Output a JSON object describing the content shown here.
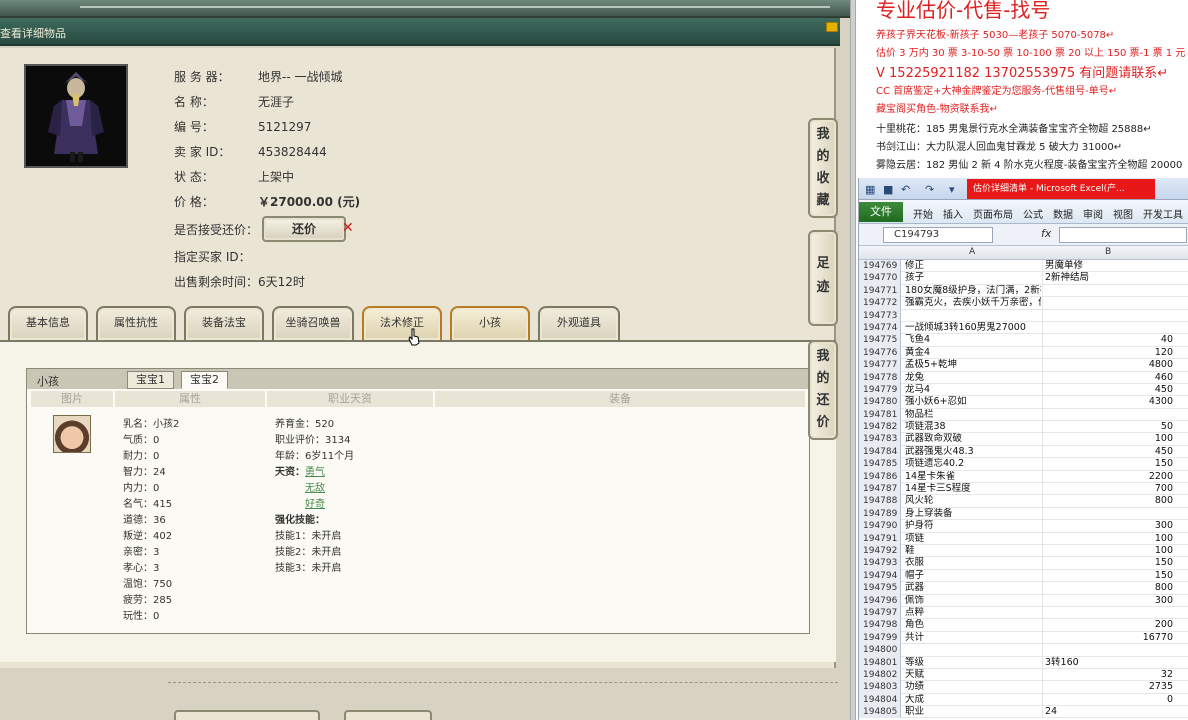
{
  "game": {
    "header_title": "查看详细物品",
    "info": {
      "server_label": "服 务 器：",
      "server_value": "地界-- 一战倾城",
      "name_label": "名 称：",
      "name_value": "无涯子",
      "id_label": "编 号：",
      "id_value": "5121297",
      "seller_label": "卖 家 ID：",
      "seller_value": "453828444",
      "status_label": "状 态：",
      "status_value": "上架中",
      "price_label": "价 格：",
      "price_value": "￥27000.00 (元)",
      "counter_label": "是否接受还价：",
      "counter_button": "还价",
      "buyer_label": "指定买家 ID：",
      "buyer_value": "",
      "remaining_label": "出售剩余时间：",
      "remaining_value": "6天12时"
    },
    "tabs": [
      "基本信息",
      "属性抗性",
      "装备法宝",
      "坐骑召唤兽",
      "法术修正",
      "小孩",
      "外观道具"
    ],
    "side_buttons": [
      "我的收藏",
      "足迹",
      "我的还价"
    ],
    "child_panel": {
      "title": "小孩",
      "subtabs": [
        "宝宝1",
        "宝宝2"
      ],
      "columns": [
        "图片",
        "属性",
        "职业天资",
        "装备"
      ],
      "stats_col1": [
        "乳名：小孩2",
        "气质：0",
        "耐力：0",
        "智力：24",
        "内力：0",
        "名气：415",
        "道德：36",
        "叛逆：402",
        "亲密：3",
        "孝心：3",
        "温饱：750",
        "疲劳：285",
        "玩性：0"
      ],
      "stats_col2": [
        "养育金：520",
        "职业评价：3134",
        "年龄：6岁11个月",
        "天资："
      ],
      "talents": [
        "勇气",
        "无敌",
        "好奇"
      ],
      "skills_label": "强化技能：",
      "skills": [
        "技能1：未开启",
        "技能2：未开启",
        "技能3：未开启"
      ]
    }
  },
  "notes": {
    "title": "专业估价-代售-找号",
    "lines": [
      {
        "text": "养孩子界天花板-新孩子 5030—老孩子 5070-5078↵",
        "style": "red"
      },
      {
        "text": "估价 3 万内 30 票 3-10-50 票 10-100 票 20 以上 150 票-1 票 1 元",
        "style": "red"
      },
      {
        "text": "V 15225921182    13702553975 有问题请联系↵",
        "style": "red big"
      },
      {
        "text": "CC 首席鉴定+大神金牌鉴定为您服务-代售组号-单号↵",
        "style": "red"
      },
      {
        "text": "藏宝阁买角色-物资联系我↵",
        "style": "red"
      },
      {
        "text": "十里桃花：185 男鬼景行克水全满装备宝宝齐全物超 25888↵",
        "style": "dark"
      },
      {
        "text": "书剑江山：大力队混人回血鬼甘霖龙 5 破大力 31000↵",
        "style": "dark"
      },
      {
        "text": "雾隐云居：182 男仙 2 新 4 阶水克火程度-装备宝宝齐全物超 20000",
        "style": "dark"
      }
    ]
  },
  "excel": {
    "window_title": "估价详细清单 - Microsoft Excel(产...",
    "file_tab": "文件",
    "menus": [
      "开始",
      "插入",
      "页面布局",
      "公式",
      "数据",
      "审阅",
      "视图",
      "开发工具"
    ],
    "name_box": "C194793",
    "fx": "fx",
    "col_a": "A",
    "col_b": "B",
    "rows": [
      {
        "n": "194769",
        "a": "修正",
        "b": "男魔单修",
        "num": false
      },
      {
        "n": "194770",
        "a": "孩子",
        "b": "2新神结局",
        "num": false
      },
      {
        "n": "194771",
        "a": "180女魔8级护身，法门满，2新神孩子，传世惊鸿4-4",
        "b": "",
        "num": false
      },
      {
        "n": "194772",
        "a": "强霸克火，去疾小妖千万亲密，价格合适",
        "b": "",
        "num": false
      },
      {
        "n": "194773",
        "a": "",
        "b": "",
        "num": false
      },
      {
        "n": "194774",
        "a": "一战倾城3转160男鬼27000",
        "b": "",
        "num": false
      },
      {
        "n": "194775",
        "a": "飞鱼4",
        "b": "40",
        "num": true
      },
      {
        "n": "194776",
        "a": "黄金4",
        "b": "120",
        "num": true
      },
      {
        "n": "194777",
        "a": "孟极5+乾坤",
        "b": "4800",
        "num": true
      },
      {
        "n": "194778",
        "a": "龙兔",
        "b": "460",
        "num": true
      },
      {
        "n": "194779",
        "a": "龙马4",
        "b": "450",
        "num": true
      },
      {
        "n": "194780",
        "a": "强小妖6+忍如",
        "b": "4300",
        "num": true
      },
      {
        "n": "194781",
        "a": "物品栏",
        "b": "",
        "num": false
      },
      {
        "n": "194782",
        "a": "项链混38",
        "b": "50",
        "num": true
      },
      {
        "n": "194783",
        "a": "武器致命双破",
        "b": "100",
        "num": true
      },
      {
        "n": "194784",
        "a": "武器强鬼火48.3",
        "b": "450",
        "num": true
      },
      {
        "n": "194785",
        "a": "项链遗忘40.2",
        "b": "150",
        "num": true
      },
      {
        "n": "194786",
        "a": "14星卡朱雀",
        "b": "2200",
        "num": true
      },
      {
        "n": "194787",
        "a": "14星卡三S程度",
        "b": "700",
        "num": true
      },
      {
        "n": "194788",
        "a": "风火轮",
        "b": "800",
        "num": true
      },
      {
        "n": "194789",
        "a": "身上穿装备",
        "b": "",
        "num": false
      },
      {
        "n": "194790",
        "a": "护身符",
        "b": "300",
        "num": true
      },
      {
        "n": "194791",
        "a": "项链",
        "b": "100",
        "num": true
      },
      {
        "n": "194792",
        "a": "鞋",
        "b": "100",
        "num": true
      },
      {
        "n": "194793",
        "a": "衣服",
        "b": "150",
        "num": true
      },
      {
        "n": "194794",
        "a": "帽子",
        "b": "150",
        "num": true
      },
      {
        "n": "194795",
        "a": "武器",
        "b": "800",
        "num": true
      },
      {
        "n": "194796",
        "a": "佩饰",
        "b": "300",
        "num": true
      },
      {
        "n": "194797",
        "a": "点粹",
        "b": "",
        "num": false
      },
      {
        "n": "194798",
        "a": "角色",
        "b": "200",
        "num": true
      },
      {
        "n": "194799",
        "a": "共计",
        "b": "16770",
        "num": true
      },
      {
        "n": "194800",
        "a": "",
        "b": "",
        "num": false
      },
      {
        "n": "194801",
        "a": "等级",
        "b": "3转160",
        "num": false
      },
      {
        "n": "194802",
        "a": "天赋",
        "b": "32",
        "num": true
      },
      {
        "n": "194803",
        "a": "功绩",
        "b": "2735",
        "num": true
      },
      {
        "n": "194804",
        "a": "大成",
        "b": "0",
        "num": true
      },
      {
        "n": "194805",
        "a": "职业",
        "b": "24",
        "num": false
      }
    ]
  },
  "colors": {
    "header_green": "#284a40",
    "price_red": "#cc2200",
    "note_red": "#e02020",
    "excel_file_green": "#1f6b1f",
    "excel_title_red": "#e81818"
  }
}
